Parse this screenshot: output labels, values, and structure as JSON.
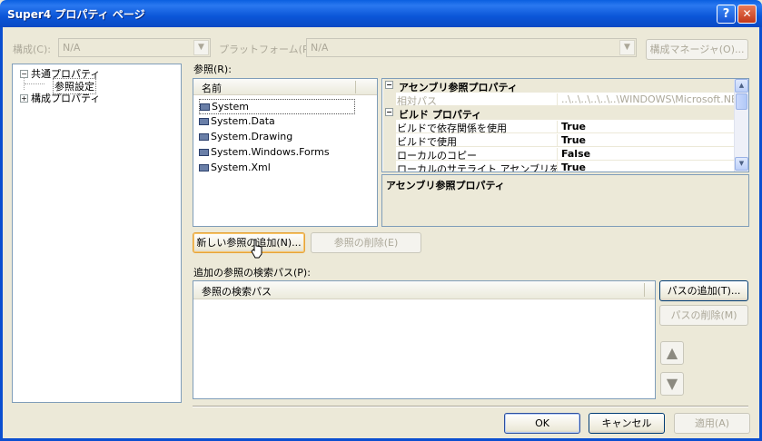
{
  "window": {
    "title": "Super4 プロパティ ページ",
    "help_glyph": "?",
    "close_glyph": "✕"
  },
  "config": {
    "config_label": "構成(C):",
    "config_value": "N/A",
    "platform_label": "プラットフォーム(P):",
    "platform_value": "N/A",
    "manager_button": "構成マネージャ(O)..."
  },
  "tree": {
    "items": [
      {
        "label": "共通プロパティ",
        "expander": "−"
      },
      {
        "label": "参照設定"
      },
      {
        "label": "構成プロパティ",
        "expander": "+"
      }
    ]
  },
  "references": {
    "label": "参照(R):",
    "column_header": "名前",
    "items": [
      "System",
      "System.Data",
      "System.Drawing",
      "System.Windows.Forms",
      "System.Xml"
    ]
  },
  "property_grid": {
    "rows": [
      {
        "type": "category",
        "label": "アセンブリ参照プロパティ",
        "expander": "−"
      },
      {
        "type": "prop",
        "name": "相対パス",
        "value": "..\\..\\..\\..\\..\\..\\WINDOWS\\Microsoft.NET\\",
        "dim": true
      },
      {
        "type": "category",
        "label": "ビルド プロパティ",
        "expander": "−"
      },
      {
        "type": "prop",
        "name": "ビルドで依存関係を使用",
        "value": "True"
      },
      {
        "type": "prop",
        "name": "ビルドで使用",
        "value": "True"
      },
      {
        "type": "prop",
        "name": "ローカルのコピー",
        "value": "False"
      },
      {
        "type": "prop",
        "name": "ローカルのサテライト アセンブリをコピー",
        "value": "True"
      }
    ],
    "description_title": "アセンブリ参照プロパティ"
  },
  "actions": {
    "add_reference": "新しい参照の追加(N)...",
    "remove_reference": "参照の削除(E)"
  },
  "search_path": {
    "label": "追加の参照の検索パス(P):",
    "column_header": "参照の検索パス",
    "add_path": "パスの追加(T)...",
    "remove_path": "パスの削除(M)",
    "up_glyph": "▲",
    "down_glyph": "▼"
  },
  "footer": {
    "ok": "OK",
    "cancel": "キャンセル",
    "apply": "適用(A)"
  },
  "colors": {
    "titlebar": "#0a5fe0",
    "dialog_bg": "#ece9d8",
    "border": "#7f9db9"
  }
}
